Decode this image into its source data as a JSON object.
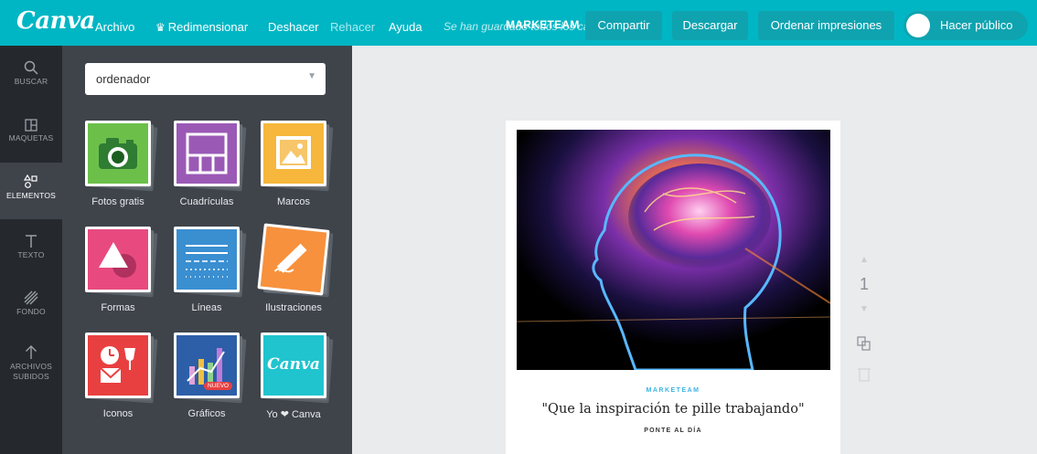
{
  "app": {
    "logo": "Canva"
  },
  "topbar": {
    "menu": {
      "archivo": "Archivo",
      "redimensionar": "Redimensionar",
      "deshacer": "Deshacer",
      "rehacer": "Rehacer",
      "ayuda": "Ayuda",
      "saved_status": "Se han guardado todos los cambios"
    },
    "doc_title": "MARKETEAM",
    "buttons": {
      "compartir": "Compartir",
      "descargar": "Descargar",
      "ordenar": "Ordenar impresiones",
      "publico": "Hacer público"
    },
    "colors": {
      "bar": "#01b6c4",
      "button": "#0fa3b0"
    }
  },
  "leftnav": {
    "items": [
      {
        "label": "BUSCAR",
        "icon": "search-icon"
      },
      {
        "label": "MAQUETAS",
        "icon": "layout-icon"
      },
      {
        "label": "ELEMENTOS",
        "icon": "shapes-icon",
        "active": true
      },
      {
        "label": "TEXTO",
        "icon": "text-icon"
      },
      {
        "label": "FONDO",
        "icon": "background-icon"
      },
      {
        "label": "ARCHIVOS SUBIDOS",
        "icon": "upload-arrow-icon"
      }
    ]
  },
  "panel": {
    "search": {
      "value": "ordenador"
    },
    "tiles": [
      {
        "label": "Fotos gratis",
        "icon": "camera-icon",
        "color": "#6cc04a"
      },
      {
        "label": "Cuadrículas",
        "icon": "grid-icon",
        "color": "#9b59b6"
      },
      {
        "label": "Marcos",
        "icon": "frame-icon",
        "color": "#f6b73c"
      },
      {
        "label": "Formas",
        "icon": "shapes-tile-icon",
        "color": "#e84a7f"
      },
      {
        "label": "Líneas",
        "icon": "lines-icon",
        "color": "#3a8fd1"
      },
      {
        "label": "Ilustraciones",
        "icon": "pencil-icon",
        "color": "#f7913d"
      },
      {
        "label": "Iconos",
        "icon": "icons-icon",
        "color": "#e84040"
      },
      {
        "label": "Gráficos",
        "icon": "chart-icon",
        "color": "#2d5fa8",
        "badge": "NUEVO"
      },
      {
        "label": "Yo ❤ Canva",
        "icon": "canva-logo-icon",
        "color": "#20c4cf",
        "logo_text": "Canva"
      }
    ]
  },
  "canvas": {
    "brand": "MARKETEAM",
    "quote": "\"Que la inspiración te pille trabajando\"",
    "cta": "PONTE AL DÍA",
    "page_number": "1"
  }
}
